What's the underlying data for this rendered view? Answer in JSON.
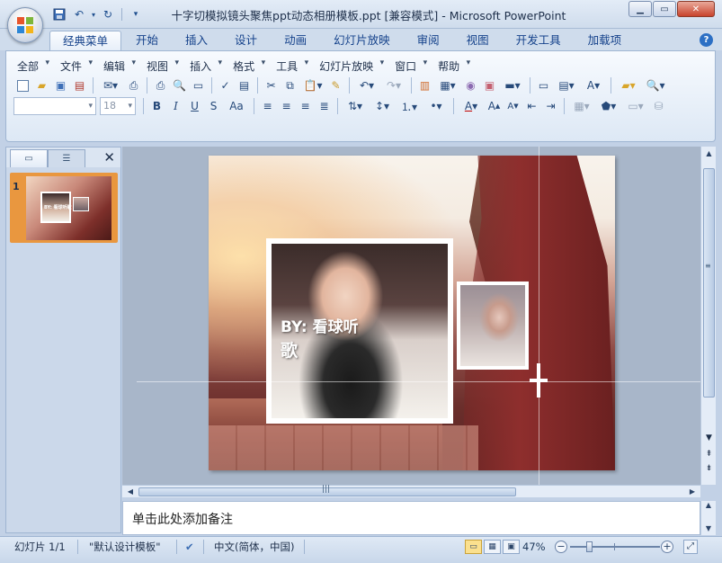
{
  "window": {
    "title": "十字切模拟镜头聚焦ppt动态相册模板.ppt [兼容模式] - Microsoft PowerPoint",
    "minimize_icon": "minimize-icon",
    "maximize_icon": "maximize-icon",
    "close_icon": "close-icon"
  },
  "quick_access": [
    "save-icon",
    "undo-icon",
    "redo-icon",
    "customize-icon"
  ],
  "ribbon_tabs": [
    {
      "label": "经典菜单",
      "active": true
    },
    {
      "label": "开始"
    },
    {
      "label": "插入"
    },
    {
      "label": "设计"
    },
    {
      "label": "动画"
    },
    {
      "label": "幻灯片放映"
    },
    {
      "label": "审阅"
    },
    {
      "label": "视图"
    },
    {
      "label": "开发工具"
    },
    {
      "label": "加载项"
    }
  ],
  "classic_menu": [
    "全部",
    "文件",
    "编辑",
    "视图",
    "插入",
    "格式",
    "工具",
    "幻灯片放映",
    "窗口",
    "帮助"
  ],
  "toolbar": {
    "font_name": "",
    "font_size": "18",
    "font_color": "#c00000",
    "format_buttons": [
      "B",
      "I",
      "U",
      "S",
      "Aa"
    ]
  },
  "slides_panel": {
    "tabs": [
      "slides-tab",
      "outline-tab"
    ],
    "close_label": "✕",
    "thumb_number": "1",
    "thumb_caption": "BY: 看球听歌"
  },
  "slide": {
    "text_line1": "BY:   看球听",
    "text_line2": "歌"
  },
  "notes": {
    "placeholder": "单击此处添加备注"
  },
  "status_bar": {
    "slide_info": "幻灯片 1/1",
    "theme": "\"默认设计模板\"",
    "language": "中文(简体，中国)",
    "zoom": "47%",
    "zoom_fraction": 0.47
  }
}
